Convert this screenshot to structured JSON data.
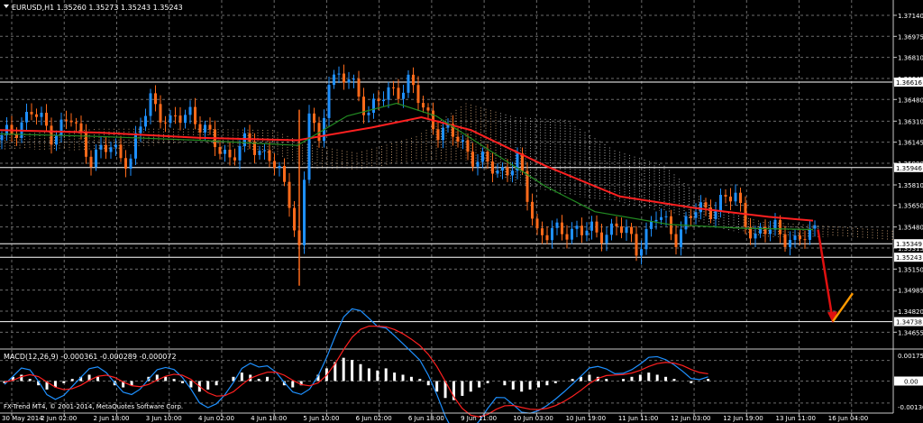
{
  "header": {
    "symbol": "EURUSD,H1",
    "ohlc": "1.35260 1.35273 1.35243 1.35243"
  },
  "macd": {
    "label": "MACD(12,26,9)",
    "values": "-0.000361 -0.000289 -0.000072"
  },
  "footer": {
    "copyright": "FX-Trend MT4, © 2001-2014, MetaQuotes Software Corp."
  },
  "colors": {
    "background": "#000000",
    "grid": "#6b6b6b",
    "bull_candle": "#1e90ff",
    "bear_candle": "#ff6a1a",
    "ma_slow": "#ff2020",
    "ma_fast": "#228b22",
    "cloud_a": "#d2a679",
    "cloud_b": "#c0c0c0",
    "macd_line": "#1e90ff",
    "signal_line": "#ff2020",
    "hline": "#ffffff"
  },
  "chart_data": {
    "type": "candlestick",
    "symbol": "EURUSD",
    "timeframe": "H1",
    "ylim": [
      1.3453,
      1.3726
    ],
    "y_ticks": [
      1.3714,
      1.36975,
      1.3681,
      1.36645,
      1.3648,
      1.3631,
      1.36145,
      1.3598,
      1.3581,
      1.3565,
      1.3548,
      1.35315,
      1.3515,
      1.34985,
      1.3482,
      1.34655
    ],
    "price_markers": [
      1.36616,
      1.35946,
      1.35349,
      1.35243,
      1.34738
    ],
    "x_ticks": [
      "30 May 2014",
      "2 Jun 02:00",
      "2 Jun 18:00",
      "3 Jun 10:00",
      "4 Jun 02:00",
      "4 Jun 18:00",
      "5 Jun 10:00",
      "6 Jun 02:00",
      "6 Jun 18:00",
      "9 Jun 11:00",
      "10 Jun 03:00",
      "10 Jun 19:00",
      "11 Jun 11:00",
      "12 Jun 03:00",
      "12 Jun 19:00",
      "13 Jun 11:00",
      "16 Jun 04:00"
    ],
    "price_path": [
      [
        0,
        1.3616
      ],
      [
        6,
        1.3638
      ],
      [
        10,
        1.3622
      ],
      [
        14,
        1.3632
      ],
      [
        18,
        1.3603
      ],
      [
        22,
        1.361
      ],
      [
        26,
        1.3601
      ],
      [
        30,
        1.365
      ],
      [
        34,
        1.3627
      ],
      [
        38,
        1.364
      ],
      [
        42,
        1.3616
      ],
      [
        46,
        1.3604
      ],
      [
        50,
        1.3614
      ],
      [
        54,
        1.3604
      ],
      [
        58,
        1.357
      ],
      [
        60,
        1.3531
      ],
      [
        62,
        1.364
      ],
      [
        64,
        1.3608
      ],
      [
        66,
        1.3668
      ],
      [
        70,
        1.3662
      ],
      [
        74,
        1.364
      ],
      [
        78,
        1.3652
      ],
      [
        82,
        1.3662
      ],
      [
        85,
        1.364
      ],
      [
        88,
        1.3625
      ],
      [
        92,
        1.3617
      ],
      [
        96,
        1.36
      ],
      [
        100,
        1.3592
      ],
      [
        104,
        1.3598
      ],
      [
        108,
        1.3545
      ],
      [
        112,
        1.3542
      ],
      [
        116,
        1.3548
      ],
      [
        120,
        1.3541
      ],
      [
        124,
        1.355
      ],
      [
        128,
        1.3532
      ],
      [
        132,
        1.3556
      ],
      [
        136,
        1.3542
      ],
      [
        140,
        1.356
      ],
      [
        144,
        1.3565
      ],
      [
        148,
        1.3572
      ],
      [
        152,
        1.3538
      ],
      [
        156,
        1.355
      ],
      [
        160,
        1.3532
      ],
      [
        162,
        1.3542
      ],
      [
        164,
        1.3549
      ]
    ],
    "ma_slow": [
      [
        0,
        1.3624
      ],
      [
        20,
        1.3622
      ],
      [
        40,
        1.3618
      ],
      [
        60,
        1.3616
      ],
      [
        75,
        1.3626
      ],
      [
        85,
        1.3634
      ],
      [
        95,
        1.3624
      ],
      [
        110,
        1.3596
      ],
      [
        125,
        1.3572
      ],
      [
        140,
        1.3563
      ],
      [
        155,
        1.3556
      ],
      [
        164,
        1.3553
      ]
    ],
    "ma_fast": [
      [
        0,
        1.3621
      ],
      [
        20,
        1.3619
      ],
      [
        40,
        1.3616
      ],
      [
        60,
        1.3612
      ],
      [
        70,
        1.3635
      ],
      [
        80,
        1.3645
      ],
      [
        88,
        1.3635
      ],
      [
        100,
        1.3605
      ],
      [
        110,
        1.358
      ],
      [
        120,
        1.356
      ],
      [
        135,
        1.355
      ],
      [
        150,
        1.3547
      ],
      [
        164,
        1.3546
      ]
    ],
    "cloud_upper": [
      [
        0,
        1.362
      ],
      [
        20,
        1.3625
      ],
      [
        40,
        1.3625
      ],
      [
        55,
        1.3624
      ],
      [
        62,
        1.3613
      ],
      [
        72,
        1.3606
      ],
      [
        84,
        1.3619
      ],
      [
        94,
        1.3645
      ],
      [
        104,
        1.3634
      ],
      [
        114,
        1.3632
      ],
      [
        124,
        1.3608
      ],
      [
        134,
        1.3596
      ],
      [
        144,
        1.3562
      ],
      [
        154,
        1.3552
      ],
      [
        170,
        1.3548
      ],
      [
        180,
        1.3545
      ]
    ],
    "cloud_lower": [
      [
        0,
        1.3609
      ],
      [
        20,
        1.3608
      ],
      [
        40,
        1.3615
      ],
      [
        55,
        1.3605
      ],
      [
        62,
        1.3594
      ],
      [
        72,
        1.3593
      ],
      [
        84,
        1.36
      ],
      [
        94,
        1.36
      ],
      [
        104,
        1.3582
      ],
      [
        114,
        1.3573
      ],
      [
        124,
        1.3568
      ],
      [
        134,
        1.356
      ],
      [
        144,
        1.3548
      ],
      [
        154,
        1.354
      ],
      [
        170,
        1.354
      ],
      [
        180,
        1.3538
      ]
    ],
    "forecast": {
      "drop_from": [
        165,
        1.3546
      ],
      "drop_to": [
        168,
        1.3474
      ],
      "rebound_to": [
        172,
        1.3496
      ]
    },
    "macd_range": [
      -0.0013,
      0.0013
    ],
    "macd_ticks": [
      0.00175,
      0.0,
      -0.00136
    ],
    "macd_hist": [
      -0.0001,
      0.0002,
      0.0003,
      0.0001,
      -0.0002,
      -0.0004,
      -0.0003,
      -0.0001,
      0.0001,
      0.0002,
      0.0003,
      0.0002,
      0.0,
      -0.0002,
      -0.0003,
      -0.0002,
      0.0,
      0.0002,
      0.0003,
      0.0002,
      0.0001,
      -0.0001,
      -0.0003,
      -0.0005,
      -0.0004,
      -0.0002,
      0.0,
      0.0002,
      0.0004,
      0.0003,
      0.0001,
      0.0002,
      0.0,
      -0.0002,
      -0.0003,
      -0.0002,
      0.0,
      0.0003,
      0.0006,
      0.0009,
      0.0011,
      0.001,
      0.0008,
      0.0006,
      0.0005,
      0.0006,
      0.0004,
      0.0003,
      0.0002,
      0.0001,
      -0.0002,
      -0.0005,
      -0.0008,
      -0.0009,
      -0.0007,
      -0.0005,
      -0.0003,
      -0.0001,
      0.0,
      -0.0002,
      -0.0004,
      -0.0005,
      -0.0004,
      -0.0003,
      -0.0002,
      -0.0001,
      0.0,
      0.0001,
      0.0002,
      0.0003,
      0.0002,
      0.0001,
      0.0,
      0.0001,
      0.0002,
      0.0003,
      0.0004,
      0.0003,
      0.0002,
      0.0001,
      0.0,
      -0.0001,
      0.0,
      0.0001
    ]
  }
}
